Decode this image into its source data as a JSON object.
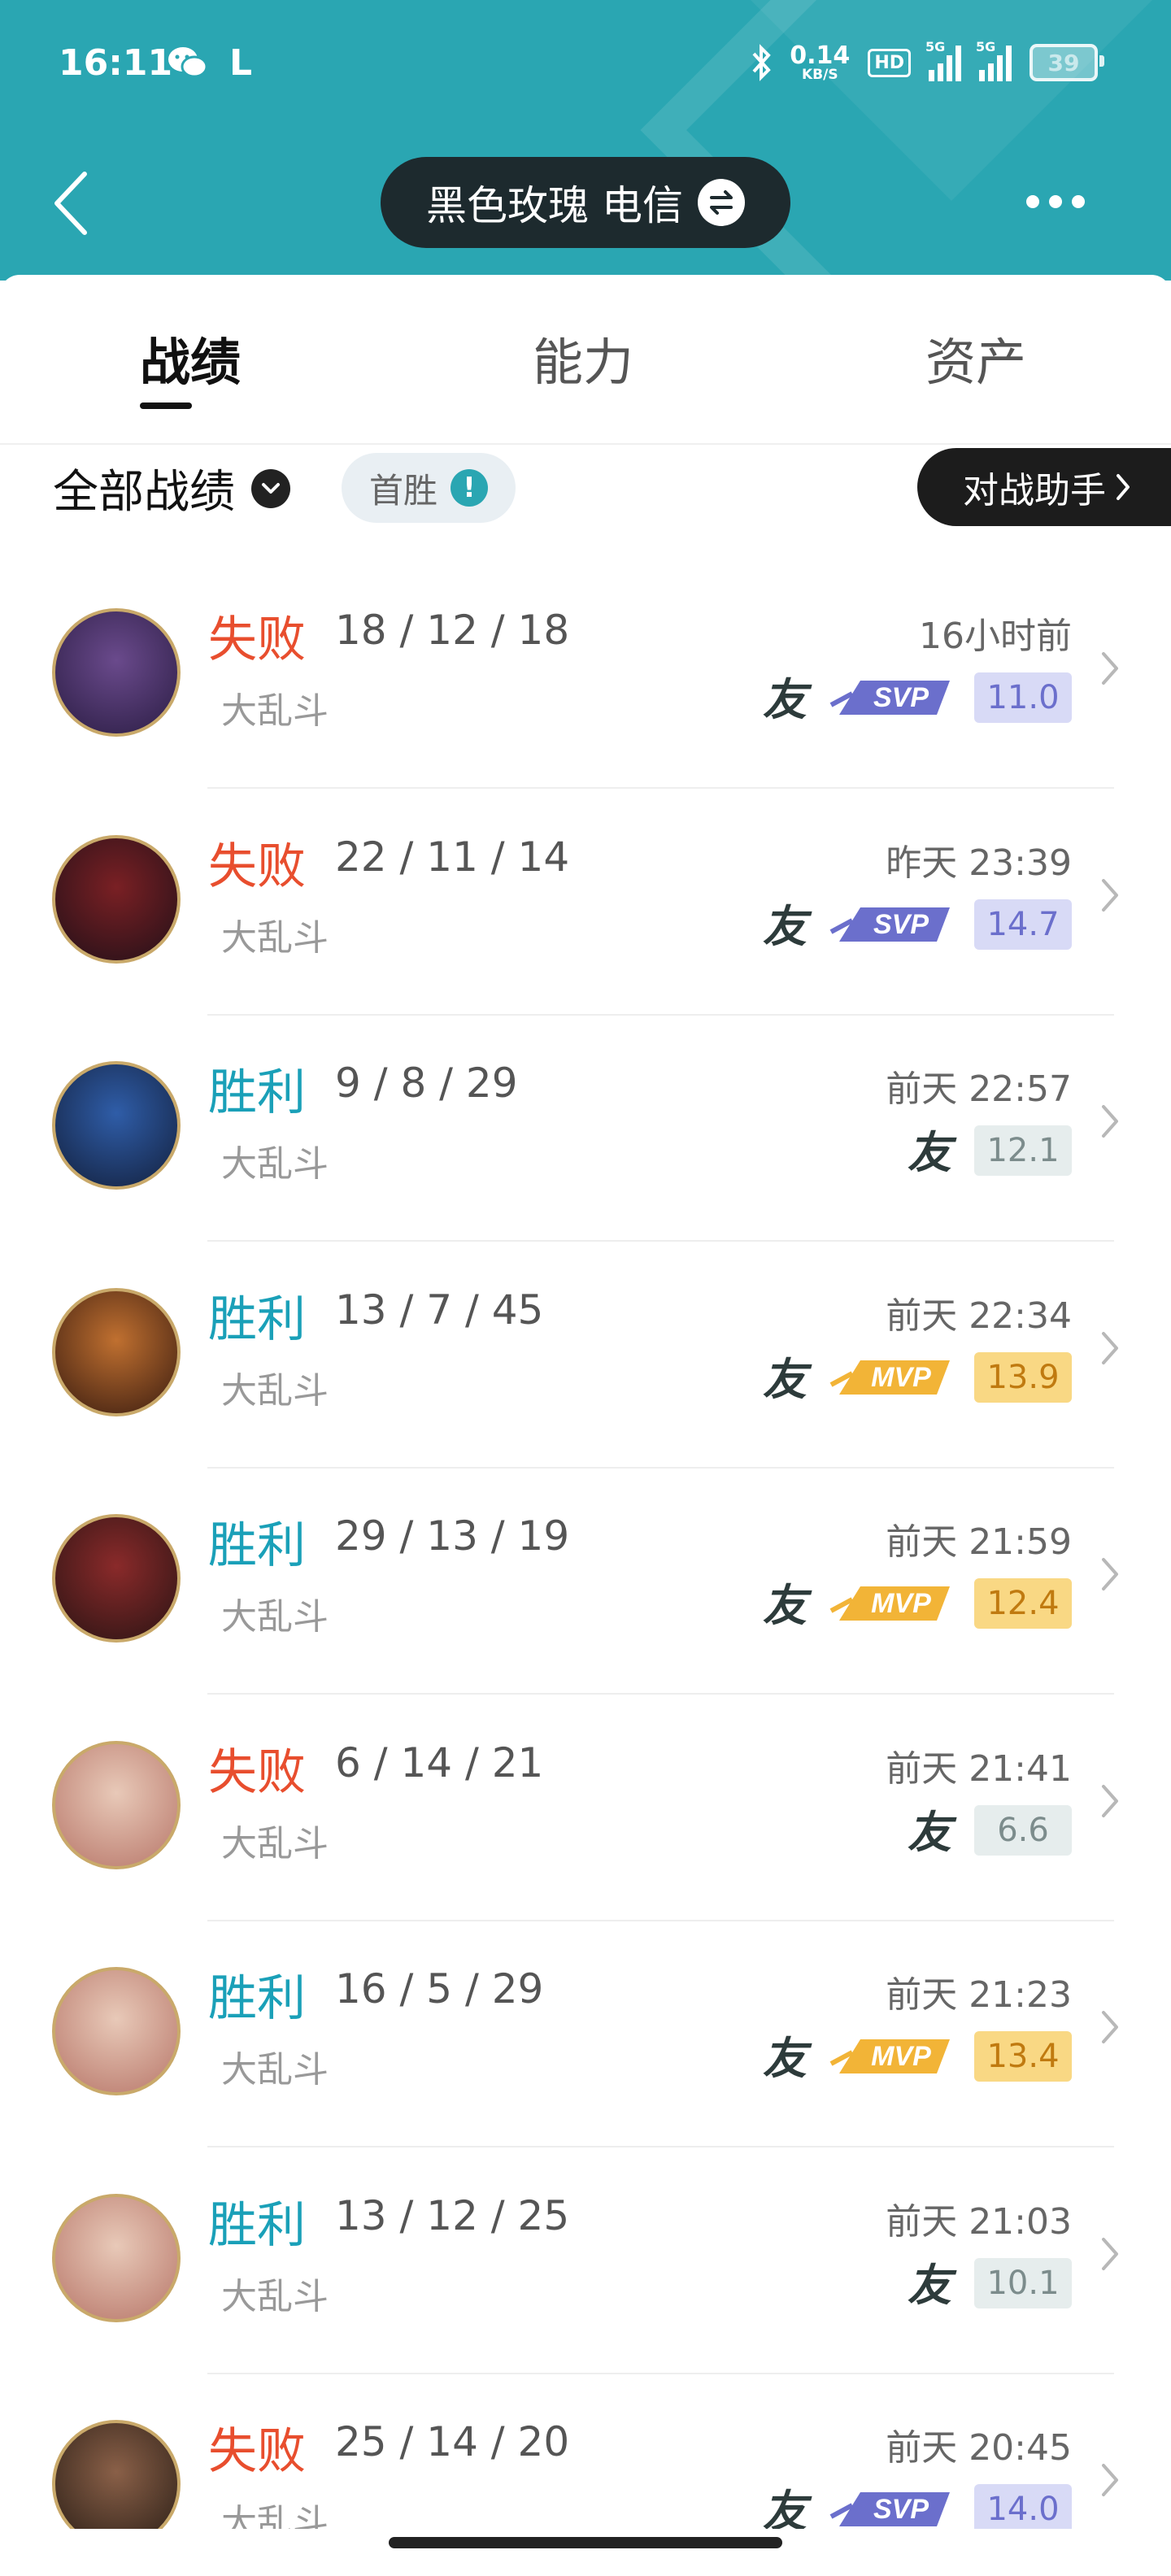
{
  "status_bar": {
    "time": "16:11",
    "carrier_letter": "L",
    "net_speed_value": "0.14",
    "net_speed_unit": "KB/S",
    "hd_label": "HD",
    "signal1_label": "5G",
    "signal2_label": "5G",
    "battery": "39"
  },
  "header": {
    "account_name": "黑色玫瑰 电信"
  },
  "tabs": [
    {
      "label": "战绩",
      "active": true
    },
    {
      "label": "能力",
      "active": false
    },
    {
      "label": "资产",
      "active": false
    }
  ],
  "filter": {
    "label": "全部战绩",
    "first_win_label": "首胜",
    "info_mark": "!",
    "assistant_label": "对战助手"
  },
  "friend_label": "友",
  "matches": [
    {
      "result": "失败",
      "win": false,
      "kda": "18 / 12 / 18",
      "mode": "大乱斗",
      "time": "16小时前",
      "badge": "SVP",
      "score": "11.0"
    },
    {
      "result": "失败",
      "win": false,
      "kda": "22 / 11 / 14",
      "mode": "大乱斗",
      "time": "昨天 23:39",
      "badge": "SVP",
      "score": "14.7"
    },
    {
      "result": "胜利",
      "win": true,
      "kda": "9 / 8 / 29",
      "mode": "大乱斗",
      "time": "前天 22:57",
      "badge": "",
      "score": "12.1"
    },
    {
      "result": "胜利",
      "win": true,
      "kda": "13 / 7 / 45",
      "mode": "大乱斗",
      "time": "前天 22:34",
      "badge": "MVP",
      "score": "13.9"
    },
    {
      "result": "胜利",
      "win": true,
      "kda": "29 / 13 / 19",
      "mode": "大乱斗",
      "time": "前天 21:59",
      "badge": "MVP",
      "score": "12.4"
    },
    {
      "result": "失败",
      "win": false,
      "kda": "6 / 14 / 21",
      "mode": "大乱斗",
      "time": "前天 21:41",
      "badge": "",
      "score": "6.6"
    },
    {
      "result": "胜利",
      "win": true,
      "kda": "16 / 5 / 29",
      "mode": "大乱斗",
      "time": "前天 21:23",
      "badge": "MVP",
      "score": "13.4"
    },
    {
      "result": "胜利",
      "win": true,
      "kda": "13 / 12 / 25",
      "mode": "大乱斗",
      "time": "前天 21:03",
      "badge": "",
      "score": "10.1"
    },
    {
      "result": "失败",
      "win": false,
      "kda": "25 / 14 / 20",
      "mode": "大乱斗",
      "time": "前天 20:45",
      "badge": "SVP",
      "score": "14.0"
    }
  ],
  "colors": {
    "header_teal": "#2aa6b2",
    "win": "#1aa0b8",
    "loss": "#e84e2e",
    "svp": "#6b6fcc",
    "mvp": "#f2b437"
  }
}
